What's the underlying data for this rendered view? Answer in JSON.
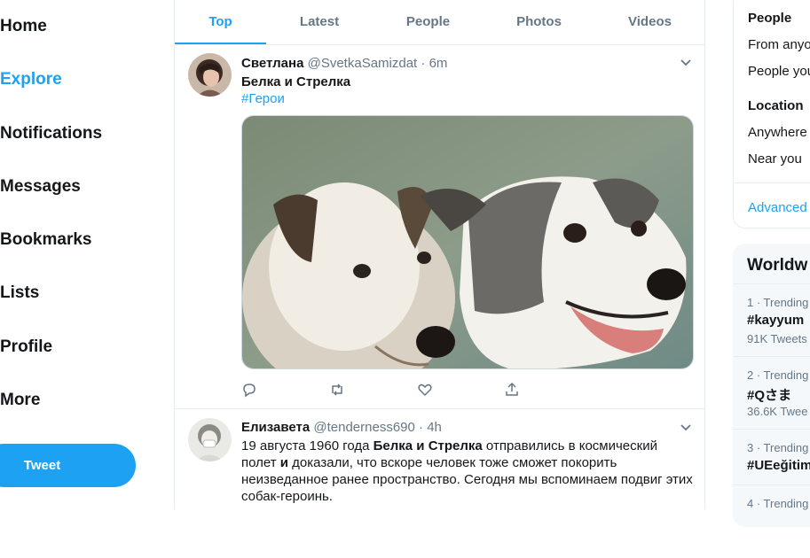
{
  "nav": {
    "items": [
      {
        "label": "Home"
      },
      {
        "label": "Explore",
        "active": true
      },
      {
        "label": "Notifications"
      },
      {
        "label": "Messages"
      },
      {
        "label": "Bookmarks"
      },
      {
        "label": "Lists"
      },
      {
        "label": "Profile"
      },
      {
        "label": "More"
      }
    ],
    "tweet_button": "Tweet"
  },
  "tabs": [
    {
      "label": "Top",
      "active": true
    },
    {
      "label": "Latest"
    },
    {
      "label": "People"
    },
    {
      "label": "Photos"
    },
    {
      "label": "Videos"
    }
  ],
  "tweets": [
    {
      "name": "Светлана",
      "handle": "@SvetkaSamizdat",
      "time": "6m",
      "text": "Белка и Стрелка",
      "hashtag": "#Герои",
      "media_icon": "dogs-photo"
    },
    {
      "name": "Елизавета",
      "handle": "@tenderness690",
      "time": "4h",
      "text_parts": [
        "19 августа 1960 года ",
        "Белка и Стрелка",
        " отправились в космический полет ",
        "и",
        " доказали, что вскоре человек тоже сможет покорить неизведанное ранее пространство. Сегодня мы вспоминаем подвиг этих собак-героинь."
      ]
    }
  ],
  "filters": {
    "people_heading": "People",
    "people_options": [
      "From anyo",
      "People you"
    ],
    "location_heading": "Location",
    "location_options": [
      "Anywhere",
      "Near you"
    ],
    "advanced_link": "Advanced s"
  },
  "trends": {
    "title": "Worldw",
    "items": [
      {
        "meta": "1 · Trending",
        "name": "#kayyum",
        "count": "91K Tweets"
      },
      {
        "meta": "2 · Trending",
        "name": "#Qさま",
        "count": "36.6K Twee"
      },
      {
        "meta": "3 · Trending",
        "name": "#UEeğitim",
        "count": ""
      },
      {
        "meta": "4 · Trending",
        "name": "",
        "count": ""
      }
    ]
  },
  "colors": {
    "accent": "#1da1f2",
    "text": "#14171a",
    "muted": "#657786",
    "border": "#e6ecf0"
  }
}
